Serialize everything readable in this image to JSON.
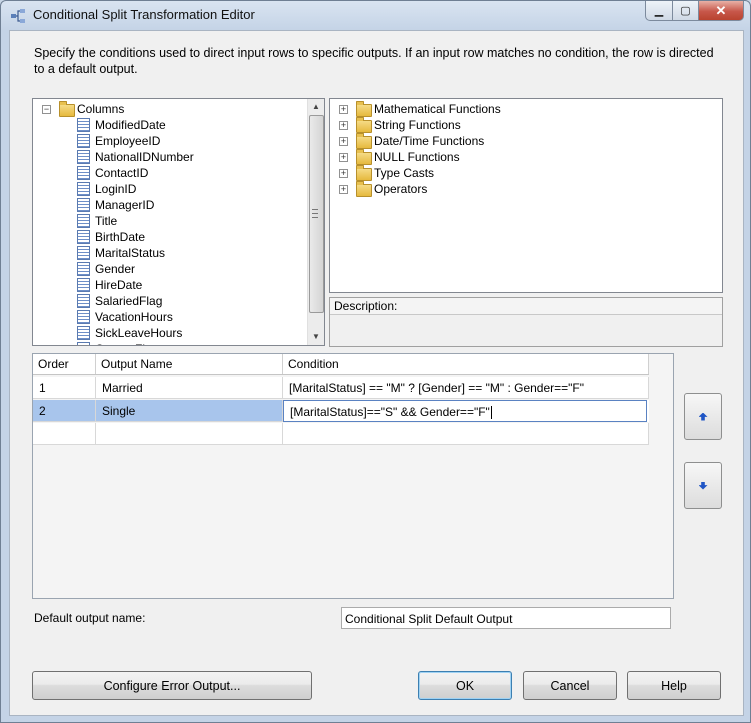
{
  "window": {
    "title": "Conditional Split Transformation Editor",
    "controls": {
      "minimize": "▁",
      "maximize": "▢",
      "close": "✕"
    }
  },
  "description": "Specify the conditions used to direct input rows to specific outputs. If an input row matches no condition, the row is directed to a default output.",
  "columns_tree": {
    "root": "Columns",
    "items": [
      "ModifiedDate",
      "EmployeeID",
      "NationalIDNumber",
      "ContactID",
      "LoginID",
      "ManagerID",
      "Title",
      "BirthDate",
      "MaritalStatus",
      "Gender",
      "HireDate",
      "SalariedFlag",
      "VacationHours",
      "SickLeaveHours",
      "CurrentFlag"
    ]
  },
  "functions_tree": {
    "items": [
      "Mathematical Functions",
      "String Functions",
      "Date/Time Functions",
      "NULL Functions",
      "Type Casts",
      "Operators"
    ]
  },
  "description_panel": {
    "label": "Description:"
  },
  "conditions_grid": {
    "headers": [
      "Order",
      "Output Name",
      "Condition"
    ],
    "rows": [
      {
        "order": "1",
        "output_name": "Married",
        "condition": "[MaritalStatus] == \"M\" ?  [Gender] == \"M\" : Gender==\"F\""
      },
      {
        "order": "2",
        "output_name": "Single",
        "condition": "[MaritalStatus]==\"S\" && Gender==\"F\""
      }
    ]
  },
  "default_output": {
    "label": "Default output name:",
    "value": "Conditional Split Default Output"
  },
  "buttons": {
    "configure_error": "Configure Error Output...",
    "ok": "OK",
    "cancel": "Cancel",
    "help": "Help"
  }
}
